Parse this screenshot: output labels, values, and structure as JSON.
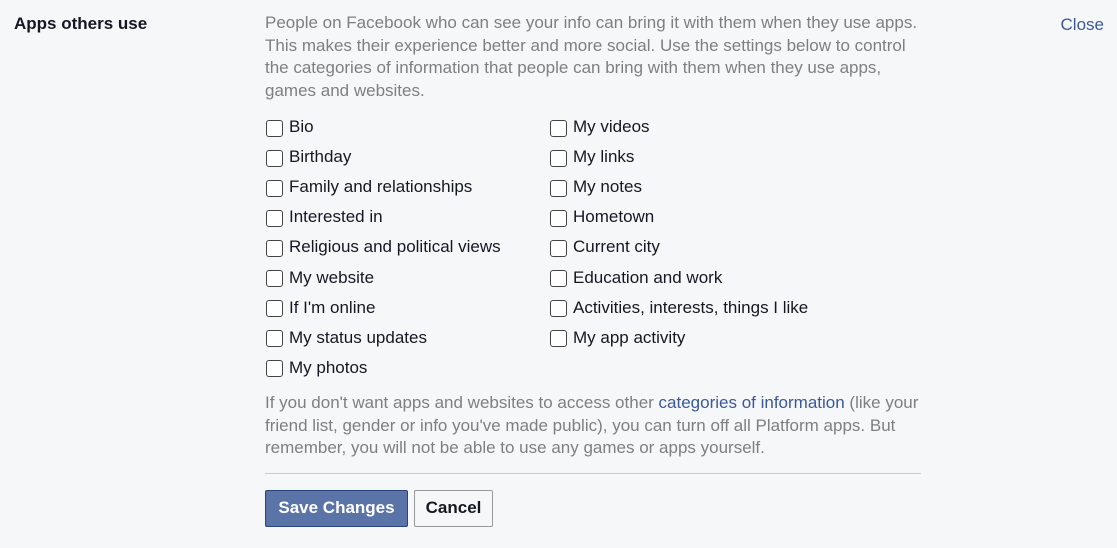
{
  "section": {
    "title": "Apps others use",
    "close_label": "Close"
  },
  "description": "People on Facebook who can see your info can bring it with them when they use apps. This makes their experience better and more social. Use the settings below to control the categories of information that people can bring with them when they use apps, games and websites.",
  "checkboxes": {
    "left": [
      {
        "label": "Bio",
        "checked": false
      },
      {
        "label": "Birthday",
        "checked": false
      },
      {
        "label": "Family and relationships",
        "checked": false
      },
      {
        "label": "Interested in",
        "checked": false
      },
      {
        "label": "Religious and political views",
        "checked": false
      },
      {
        "label": "My website",
        "checked": false
      },
      {
        "label": "If I'm online",
        "checked": false
      },
      {
        "label": "My status updates",
        "checked": false
      },
      {
        "label": "My photos",
        "checked": false
      }
    ],
    "right": [
      {
        "label": "My videos",
        "checked": false
      },
      {
        "label": "My links",
        "checked": false
      },
      {
        "label": "My notes",
        "checked": false
      },
      {
        "label": "Hometown",
        "checked": false
      },
      {
        "label": "Current city",
        "checked": false
      },
      {
        "label": "Education and work",
        "checked": false
      },
      {
        "label": "Activities, interests, things I like",
        "checked": false
      },
      {
        "label": "My app activity",
        "checked": false
      }
    ]
  },
  "footer_note": {
    "before": "If you don't want apps and websites to access other ",
    "link": "categories of information",
    "after": " (like your friend list, gender or info you've made public), you can turn off all Platform apps. But remember, you will not be able to use any games or apps yourself."
  },
  "actions": {
    "save_label": "Save Changes",
    "cancel_label": "Cancel"
  },
  "colors": {
    "background": "#f6f7f9",
    "link": "#3b5998",
    "primary_button": "#5b74a8",
    "muted_text": "#7f7f7f"
  }
}
